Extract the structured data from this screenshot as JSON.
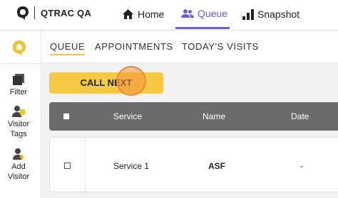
{
  "app": {
    "brand_name": "QTRAC QA",
    "accent_color": "#6a5fd0",
    "call_color": "#f6c944"
  },
  "topnav": {
    "home": "Home",
    "queue": "Queue",
    "snapshot": "Snapshot"
  },
  "sidebar": {
    "items": [
      {
        "label": "Filter",
        "icon": "filter-icon"
      },
      {
        "label": "Visitor Tags",
        "icon": "visitor-tags-icon"
      },
      {
        "label": "Add Visitor",
        "icon": "add-visitor-icon"
      }
    ]
  },
  "tabs": [
    "QUEUE",
    "APPOINTMENTS",
    "TODAY'S VISITS"
  ],
  "actions": {
    "call_next": "CALL NEXT"
  },
  "table": {
    "columns": [
      "Service",
      "Name",
      "Date"
    ],
    "rows": [
      {
        "service": "Service 1",
        "name": "ASF",
        "date": "-"
      }
    ]
  }
}
